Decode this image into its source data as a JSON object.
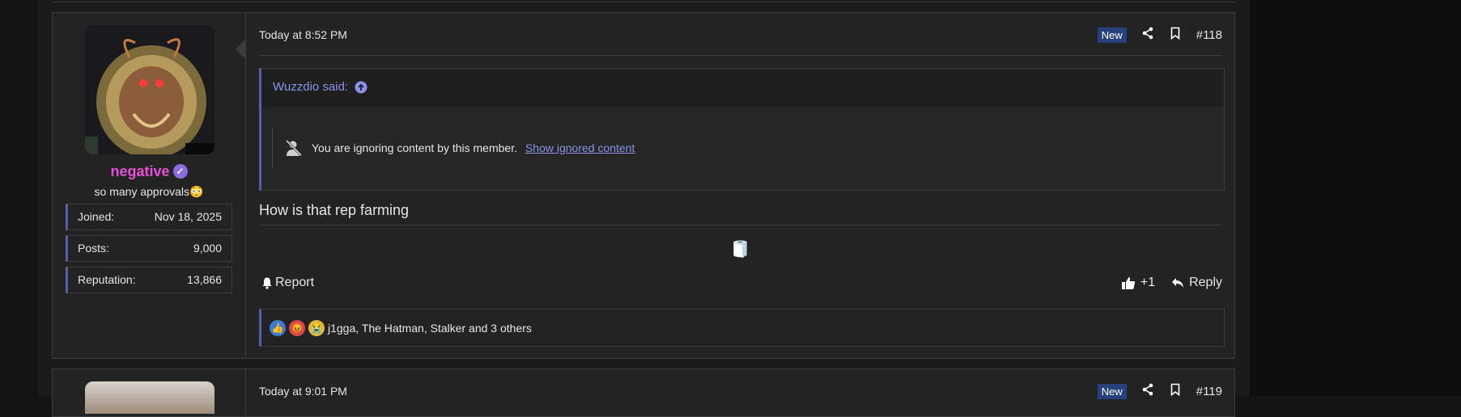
{
  "post1": {
    "date": "Today at 8:52 PM",
    "new_label": "New",
    "number": "#118",
    "user": {
      "name": "negative",
      "title": "so many approvals😳",
      "stats": [
        {
          "key": "Joined:",
          "value": "Nov 18, 2025"
        },
        {
          "key": "Posts:",
          "value": "9,000"
        },
        {
          "key": "Reputation:",
          "value": "13,866"
        }
      ]
    },
    "quote": {
      "author": "Wuzzdio said:",
      "ignored_text": "You are ignoring content by this member.",
      "show_link": "Show ignored content"
    },
    "body": "How is that rep farming",
    "footer": {
      "report": "Report",
      "plus_one": "+1",
      "reply": "Reply"
    },
    "reactions_text": "j1gga, The Hatman, Stalker and 3 others"
  },
  "post2": {
    "date": "Today at 9:01 PM",
    "new_label": "New",
    "number": "#119"
  },
  "colors": {
    "accent": "#5660a8",
    "link": "#8a93e8",
    "username": "#e64fd6",
    "new_badge": "#27417f"
  }
}
